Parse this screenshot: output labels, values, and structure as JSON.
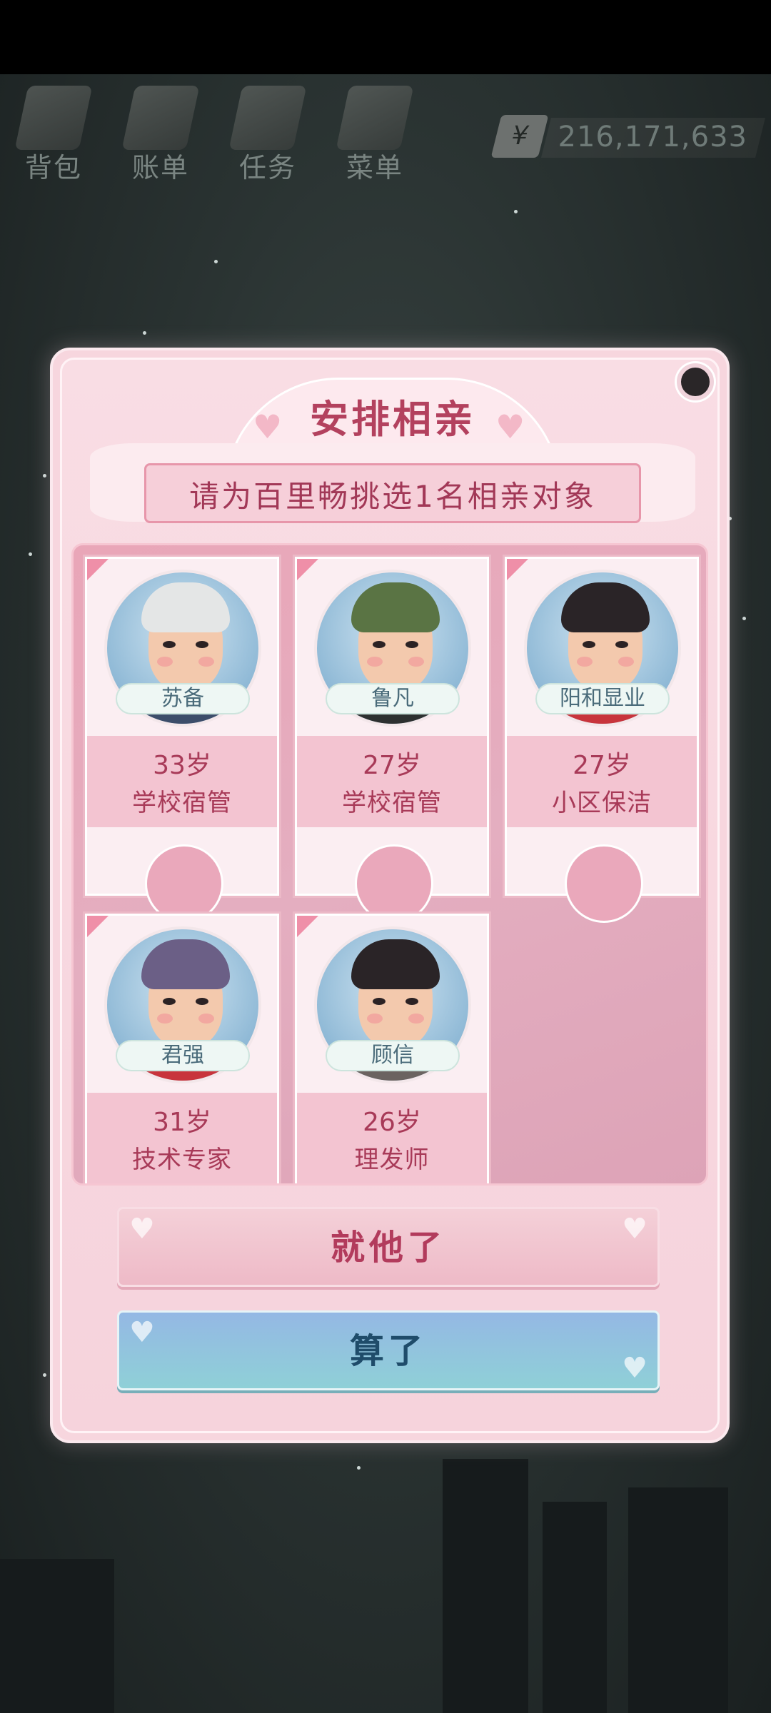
{
  "hud": {
    "items": [
      {
        "label": "背包",
        "icon": "backpack-icon"
      },
      {
        "label": "账单",
        "icon": "bill-icon"
      },
      {
        "label": "任务",
        "icon": "task-icon"
      },
      {
        "label": "菜单",
        "icon": "menu-icon"
      }
    ],
    "money": {
      "symbol": "¥",
      "value": "216,171,633"
    }
  },
  "dialog": {
    "title": "安排相亲",
    "subtitle": "请为百里畅挑选1名相亲对象",
    "candidates": [
      {
        "name": "苏备",
        "age": "33岁",
        "job": "学校宿管",
        "hair": "#e4e6e6",
        "shirt": "#3c4d6a"
      },
      {
        "name": "鲁凡",
        "age": "27岁",
        "job": "学校宿管",
        "hair": "#5a7444",
        "shirt": "#2d3030"
      },
      {
        "name": "阳和显业",
        "age": "27岁",
        "job": "小区保洁",
        "hair": "#2a2427",
        "shirt": "#c8343c"
      },
      {
        "name": "君强",
        "age": "31岁",
        "job": "技术专家",
        "hair": "#6b5f86",
        "shirt": "#c8343c"
      },
      {
        "name": "顾信",
        "age": "26岁",
        "job": "理发师",
        "hair": "#2a2427",
        "shirt": "#6b6360"
      }
    ],
    "confirm_label": "就他了",
    "cancel_label": "算了"
  },
  "colors": {
    "accent": "#b3415e",
    "panel": "#f7d6de",
    "cancel": "#8fc3dd"
  }
}
